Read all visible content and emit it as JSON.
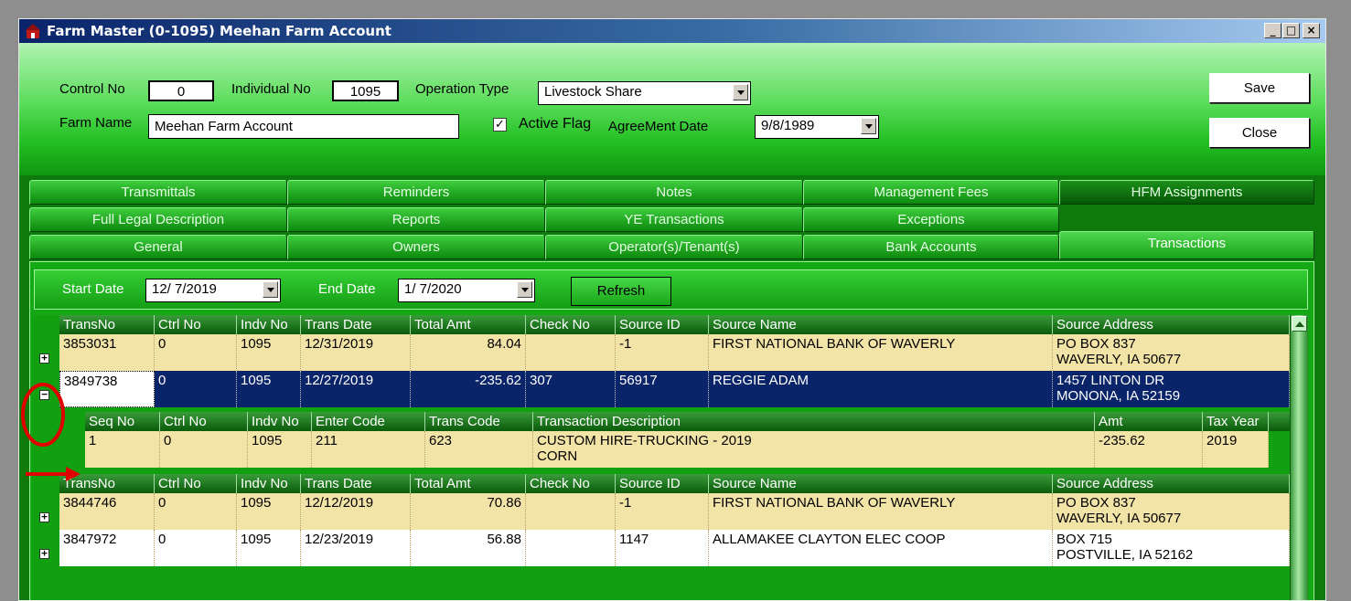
{
  "window": {
    "title": "Farm Master (0-1095) Meehan Farm Account",
    "minimize": "_",
    "maximize": "□",
    "close": "×"
  },
  "header": {
    "control_no_label": "Control No",
    "control_no": "0",
    "individual_no_label": "Individual No",
    "individual_no": "1095",
    "operation_type_label": "Operation Type",
    "operation_type": "Livestock Share",
    "farm_name_label": "Farm Name",
    "farm_name": "Meehan Farm Account",
    "active_flag_label": "Active Flag",
    "active_flag_checked": true,
    "agreement_date_label": "AgreeMent Date",
    "agreement_date": "9/8/1989",
    "save_label": "Save",
    "close_label": "Close"
  },
  "tabs": {
    "row1": [
      "Transmittals",
      "Reminders",
      "Notes",
      "Management Fees",
      "HFM Assignments"
    ],
    "row2": [
      "Full Legal Description",
      "Reports",
      "YE Transactions",
      "Exceptions"
    ],
    "row3": [
      "General",
      "Owners",
      "Operator(s)/Tenant(s)",
      "Bank Accounts",
      "Transactions"
    ],
    "selected": "Transactions"
  },
  "filter": {
    "start_date_label": "Start Date",
    "start_date": "12/ 7/2019",
    "end_date_label": "End Date",
    "end_date": "1/ 7/2020",
    "refresh_label": "Refresh"
  },
  "grid": {
    "columns": [
      "TransNo",
      "Ctrl No",
      "Indv No",
      "Trans Date",
      "Total Amt",
      "Check No",
      "Source ID",
      "Source Name",
      "Source Address"
    ],
    "rows": [
      {
        "trans_no": "3853031",
        "ctrl_no": "0",
        "indv_no": "1095",
        "trans_date": "12/31/2019",
        "total_amt": "84.04",
        "check_no": "",
        "source_id": "-1",
        "source_name": "FIRST NATIONAL BANK OF WAVERLY",
        "source_address": "PO BOX 837\nWAVERLY, IA 50677",
        "expander": "+"
      },
      {
        "trans_no": "3849738",
        "ctrl_no": "0",
        "indv_no": "1095",
        "trans_date": "12/27/2019",
        "total_amt": "-235.62",
        "check_no": "307",
        "source_id": "56917",
        "source_name": "REGGIE ADAM",
        "source_address": "1457 LINTON DR\nMONONA, IA 52159",
        "expander": "−"
      },
      {
        "trans_no": "3844746",
        "ctrl_no": "0",
        "indv_no": "1095",
        "trans_date": "12/12/2019",
        "total_amt": "70.86",
        "check_no": "",
        "source_id": "-1",
        "source_name": "FIRST NATIONAL BANK OF WAVERLY",
        "source_address": "PO BOX 837\nWAVERLY, IA 50677",
        "expander": "+"
      },
      {
        "trans_no": "3847972",
        "ctrl_no": "0",
        "indv_no": "1095",
        "trans_date": "12/23/2019",
        "total_amt": "56.88",
        "check_no": "",
        "source_id": "1147",
        "source_name": "ALLAMAKEE CLAYTON ELEC COOP",
        "source_address": "BOX 715\nPOSTVILLE, IA 52162",
        "expander": "+"
      }
    ]
  },
  "detail": {
    "columns": [
      "Seq No",
      "Ctrl No",
      "Indv No",
      "Enter Code",
      "Trans Code",
      "Transaction Description",
      "Amt",
      "Tax Year"
    ],
    "row": {
      "seq_no": "1",
      "ctrl_no": "0",
      "indv_no": "1095",
      "enter_code": "211",
      "trans_code": "623",
      "description": "CUSTOM HIRE-TRUCKING - 2019\nCORN",
      "amt": "-235.62",
      "tax_year": "2019"
    }
  },
  "colors": {
    "annotation": "#e00000",
    "selected_row": "#0a246a",
    "row_tan": "#f2e3a6"
  }
}
